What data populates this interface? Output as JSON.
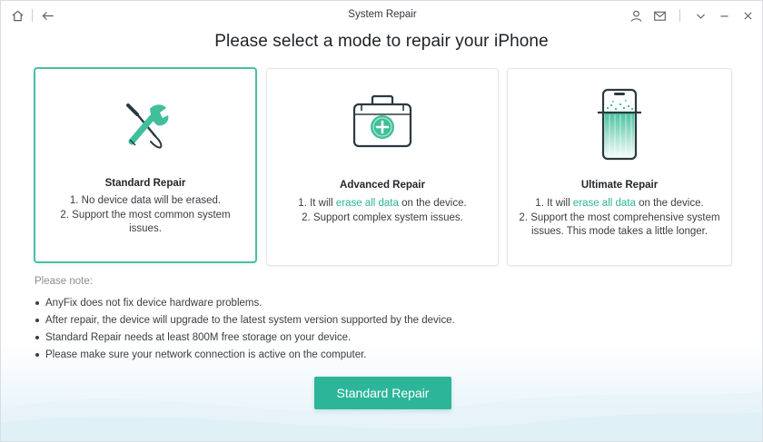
{
  "window": {
    "title": "System Repair"
  },
  "heading": "Please select a mode to repair your iPhone",
  "modes": [
    {
      "title": "Standard Repair",
      "lines": [
        [
          "1. No device data will be erased."
        ],
        [
          "2. Support the most common system issues."
        ]
      ],
      "selected": true,
      "icon": "tools-icon"
    },
    {
      "title": "Advanced Repair",
      "line1_pre": "1. It will ",
      "line1_hl": "erase all data",
      "line1_post": " on the device.",
      "line2": "2. Support complex system issues.",
      "selected": false,
      "icon": "first-aid-kit-icon"
    },
    {
      "title": "Ultimate Repair",
      "line1_pre": "1. It will ",
      "line1_hl": "erase all data",
      "line1_post": " on the device.",
      "line2": "2. Support the most comprehensive system",
      "line3": "issues. This mode takes a little longer.",
      "selected": false,
      "icon": "phone-scan-icon"
    }
  ],
  "notes": {
    "title": "Please note:",
    "items": [
      "AnyFix does not fix device hardware problems.",
      "After repair, the device will upgrade to the latest system version supported by the device.",
      "Standard Repair needs at least 800M free storage on your device.",
      "Please make sure your network connection is active on the computer."
    ]
  },
  "action": {
    "label": "Standard Repair"
  },
  "colors": {
    "accent": "#2db59a",
    "highlight": "#2cb494",
    "selected_border": "#4bbfa6"
  }
}
